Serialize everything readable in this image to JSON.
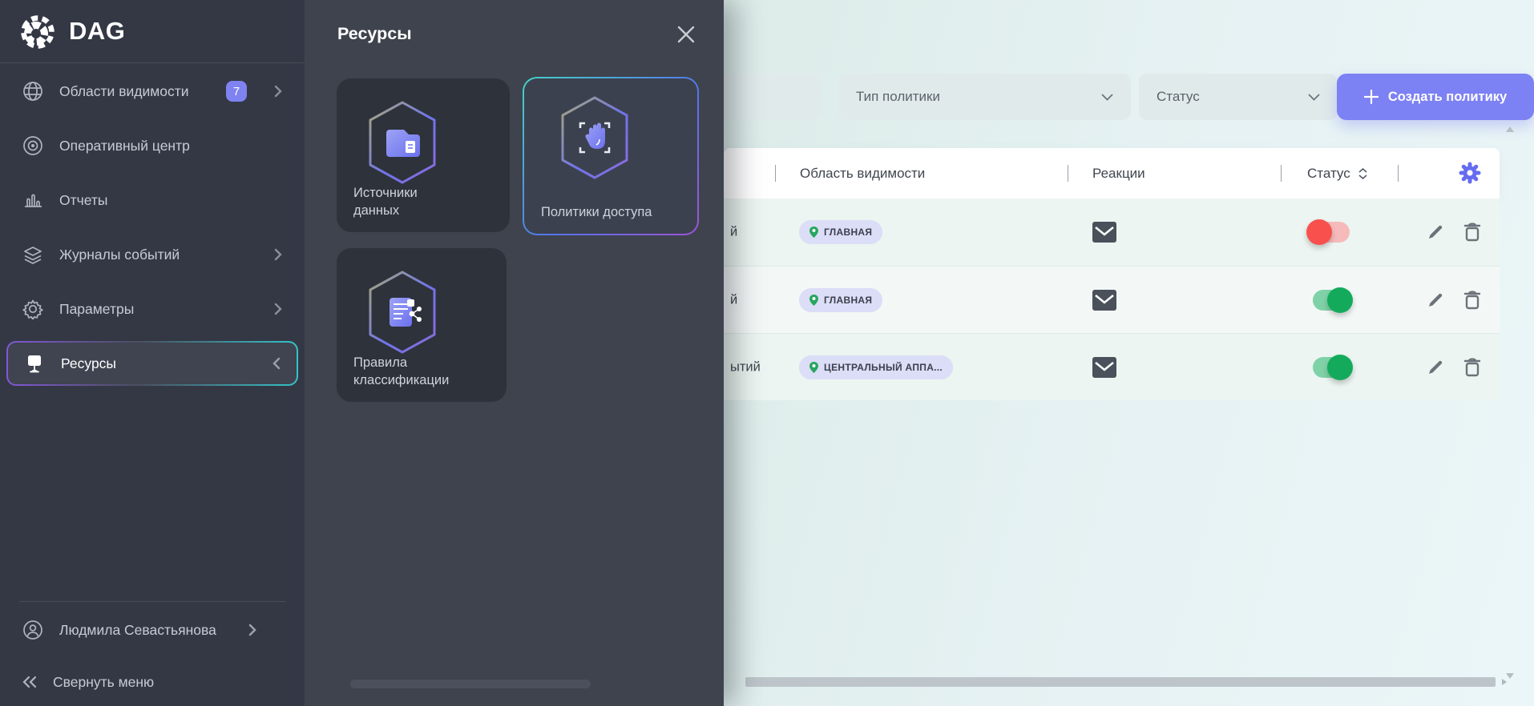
{
  "app": {
    "logo_text": "DAG"
  },
  "sidebar": {
    "items": [
      {
        "label": "Области видимости",
        "icon": "globe",
        "badge": "7",
        "chevron": "right"
      },
      {
        "label": "Оперативный центр",
        "icon": "eye"
      },
      {
        "label": "Отчеты",
        "icon": "bar-chart"
      },
      {
        "label": "Журналы событий",
        "icon": "layers",
        "chevron": "right"
      },
      {
        "label": "Параметры",
        "icon": "gear",
        "chevron": "right"
      },
      {
        "label": "Ресурсы",
        "icon": "resources",
        "chevron": "left",
        "selected": true
      }
    ],
    "user": {
      "name": "Людмила Севастьянова"
    },
    "collapse_label": "Свернуть меню"
  },
  "panel": {
    "title": "Ресурсы",
    "cards": [
      {
        "label": "Источники данных",
        "icon": "data-source",
        "selected": false
      },
      {
        "label": "Политики доступа",
        "icon": "access-policy",
        "selected": true
      },
      {
        "label": "Правила классификации",
        "icon": "classification-rules",
        "selected": false
      }
    ]
  },
  "main": {
    "filters": {
      "policy_type": "Тип политики",
      "status": "Статус"
    },
    "create_button": "Создать политику",
    "table": {
      "columns": [
        "Область видимости",
        "Реакции",
        "Статус"
      ],
      "rows": [
        {
          "name_fragment": "й",
          "scope": "ГЛАВНАЯ",
          "reaction": "email",
          "toggle": "off"
        },
        {
          "name_fragment": "й",
          "scope": "ГЛАВНАЯ",
          "reaction": "email",
          "toggle": "on"
        },
        {
          "name_fragment": "ытий",
          "scope": "ЦЕНТРАЛЬНЫЙ АППА...",
          "reaction": "email",
          "toggle": "on"
        }
      ]
    }
  },
  "colors": {
    "accent": "#7c81f3",
    "toggle_on": "#14aa5c",
    "toggle_off": "#f8514d",
    "badge_bg": "#dcddf7",
    "pin_green": "#27a75e",
    "sidebar_bg": "#343845",
    "panel_bg": "#3e434d"
  }
}
